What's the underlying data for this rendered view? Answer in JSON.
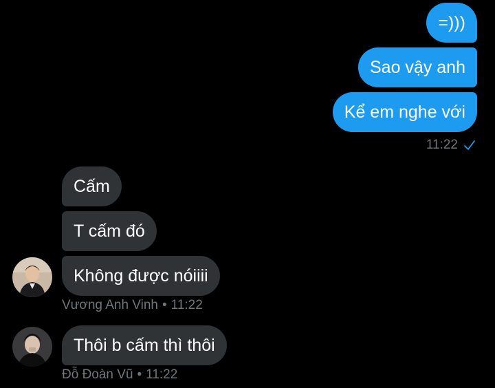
{
  "conversation": {
    "sent_messages": [
      {
        "text": "=)))"
      },
      {
        "text": "Sao vậy anh"
      },
      {
        "text": "Kể em nghe với"
      }
    ],
    "sent_time": "11:22",
    "sent_status_icon": "check-icon",
    "group_1": {
      "messages": [
        {
          "text": "Cấm"
        },
        {
          "text": "T cấm đó"
        },
        {
          "text": "Không được nóiiii"
        }
      ],
      "sender": "Vương Anh Vinh",
      "separator": "•",
      "time": "11:22",
      "avatar_icon": "avatar"
    },
    "group_2": {
      "messages": [
        {
          "text": "Thôi b cấm thì thôi"
        }
      ],
      "sender": "Đỗ Đoàn Vũ",
      "separator": "•",
      "time": "11:22",
      "avatar_icon": "avatar"
    }
  },
  "colors": {
    "background": "#000000",
    "sent_bubble": "#1d9bf0",
    "received_bubble": "#2f3336",
    "meta_text": "#71767b"
  }
}
